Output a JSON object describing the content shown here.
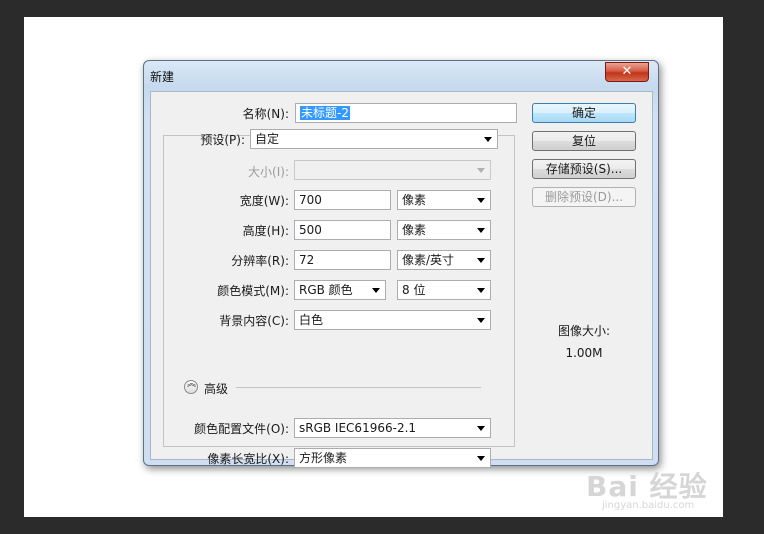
{
  "window": {
    "title": "新建",
    "close_label": "✕"
  },
  "form": {
    "name": {
      "label": "名称(N):",
      "value": "未标题-2"
    },
    "preset": {
      "label": "预设(P):",
      "value": "自定"
    },
    "size": {
      "label": "大小(I):",
      "value": ""
    },
    "width": {
      "label": "宽度(W):",
      "value": "700",
      "unit": "像素"
    },
    "height": {
      "label": "高度(H):",
      "value": "500",
      "unit": "像素"
    },
    "resolution": {
      "label": "分辨率(R):",
      "value": "72",
      "unit": "像素/英寸"
    },
    "color_mode": {
      "label": "颜色模式(M):",
      "value": "RGB 颜色",
      "depth": "8 位"
    },
    "background": {
      "label": "背景内容(C):",
      "value": "白色"
    },
    "advanced": {
      "label": "高级"
    },
    "color_profile": {
      "label": "颜色配置文件(O):",
      "value": "sRGB IEC61966-2.1"
    },
    "pixel_aspect": {
      "label": "像素长宽比(X):",
      "value": "方形像素"
    }
  },
  "buttons": {
    "ok": "确定",
    "reset": "复位",
    "save_preset": "存储预设(S)...",
    "delete_preset": "删除预设(D)..."
  },
  "image_size": {
    "label": "图像大小:",
    "value": "1.00M"
  },
  "watermark": {
    "main": "Bai 经验",
    "sub": "jingyan.baidu.com"
  },
  "colors": {
    "selection": "#3399ff",
    "titlebar": "#c6d9ee",
    "close_button": "#c2331b",
    "background": "#2b2b2b"
  }
}
